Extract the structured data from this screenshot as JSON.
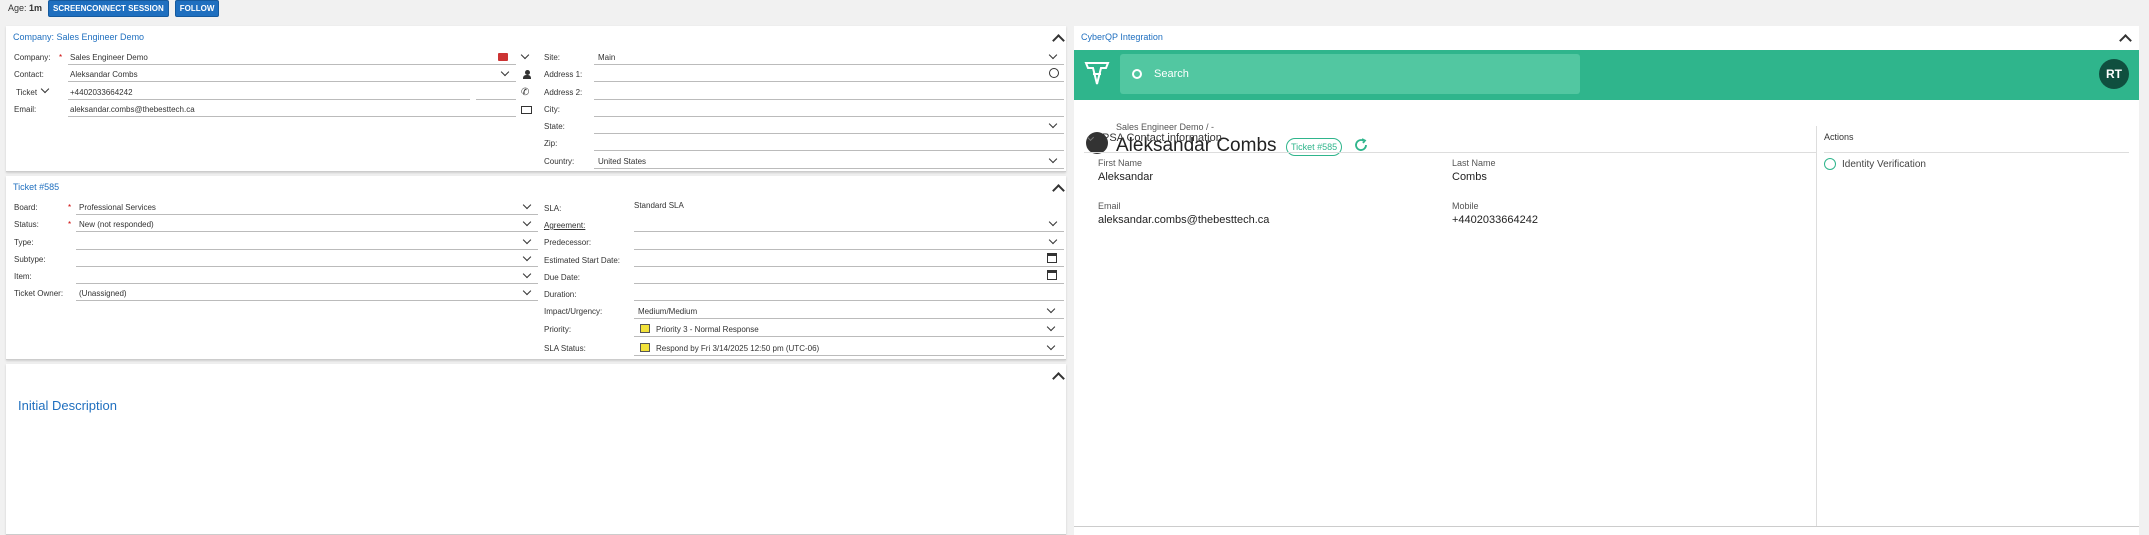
{
  "topbar": {
    "age_label": "Age:",
    "age_value": "1m",
    "screenconnect": "SCREENCONNECT SESSION",
    "follow": "FOLLOW"
  },
  "company_panel": {
    "title": "Company: Sales Engineer Demo",
    "company_label": "Company:",
    "company_value": "Sales Engineer Demo",
    "contact_label": "Contact:",
    "contact_value": "Aleksandar Combs",
    "ticket_label": "Ticket",
    "ticket_value": "+4402033664242",
    "email_label": "Email:",
    "email_value": "aleksandar.combs@thebesttech.ca",
    "site_label": "Site:",
    "site_value": "Main",
    "address1_label": "Address 1:",
    "address2_label": "Address 2:",
    "city_label": "City:",
    "state_label": "State:",
    "zip_label": "Zip:",
    "country_label": "Country:",
    "country_value": "United States"
  },
  "ticket_panel": {
    "title": "Ticket #585",
    "board_label": "Board:",
    "board_value": "Professional Services",
    "status_label": "Status:",
    "status_value": "New (not responded)",
    "type_label": "Type:",
    "subtype_label": "Subtype:",
    "item_label": "Item:",
    "owner_label": "Ticket Owner:",
    "owner_value": "(Unassigned)",
    "sla_label": "SLA:",
    "sla_value": "Standard SLA",
    "agreement_label": "Agreement:",
    "predecessor_label": "Predecessor:",
    "est_start_label": "Estimated Start Date:",
    "due_label": "Due Date:",
    "duration_label": "Duration:",
    "impact_label": "Impact/Urgency:",
    "impact_value": "Medium/Medium",
    "priority_label": "Priority:",
    "priority_value": "Priority 3 - Normal Response",
    "sla_status_label": "SLA Status:",
    "sla_status_value": "Respond by Fri 3/14/2025 12:50 pm (UTC-06)",
    "swatch_color": "#f2e23a"
  },
  "description": {
    "title": "Initial Description"
  },
  "cyberqp": {
    "title": "CyberQP Integration",
    "search_placeholder": "Search",
    "avatar": "RT",
    "breadcrumb": "Sales Engineer Demo / -",
    "contact_name": "Aleksandar Combs",
    "ticket_pill": "Ticket #585",
    "section_title": "PSA Contact information",
    "actions_title": "Actions",
    "identity_verification": "Identity Verification",
    "first_name_label": "First Name",
    "first_name": "Aleksandar",
    "last_name_label": "Last Name",
    "last_name": "Combs",
    "email_label": "Email",
    "email": "aleksandar.combs@thebesttech.ca",
    "mobile_label": "Mobile",
    "mobile": "+4402033664242",
    "brand_color": "#2fb58c"
  }
}
